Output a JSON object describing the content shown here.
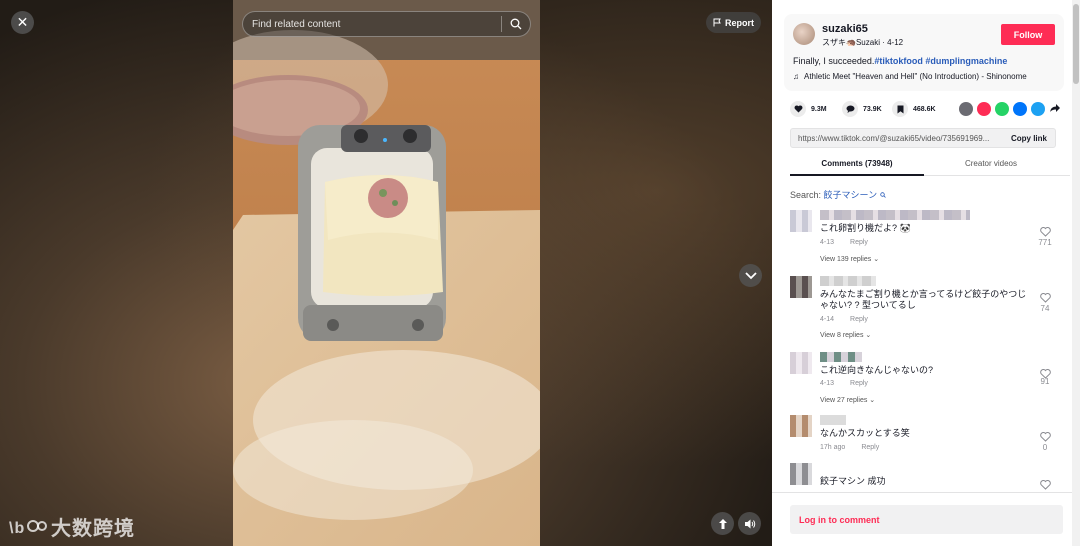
{
  "overlay": {
    "search_placeholder": "Find related content",
    "report_label": "Report",
    "watermark_text": "大数跨境"
  },
  "author": {
    "username": "suzaki65",
    "display": "スザキ🦔Suzaki",
    "date": "4-12",
    "follow_label": "Follow"
  },
  "post": {
    "desc_text": "Finally, I succeeded.",
    "hashtag1": "#tiktokfood",
    "hashtag2": "#dumplingmachine",
    "music": "Athletic Meet \"Heaven and Hell\" (No Introduction) - Shinonome"
  },
  "stats": {
    "likes": "9.3M",
    "comments": "73.9K",
    "saves": "468.6K"
  },
  "share": {
    "url": "https://www.tiktok.com/@suzaki65/video/735691969...",
    "copy_label": "Copy link"
  },
  "tabs": {
    "comments_label": "Comments (73948)",
    "creator_label": "Creator videos"
  },
  "search_suggest": {
    "prefix": "Search:",
    "term": "餃子マシーン"
  },
  "comments": [
    {
      "text": "これ卵割り機だよ? 🐼",
      "date": "4-13",
      "reply": "Reply",
      "likes": "771",
      "view_replies": "View 139 replies"
    },
    {
      "text": "みんなたまご割り機とか言ってるけど餃子のやつじゃない? ? 型ついてるし",
      "date": "4-14",
      "reply": "Reply",
      "likes": "74",
      "view_replies": "View 8 replies"
    },
    {
      "text": "これ逆向きなんじゃないの?",
      "date": "4-13",
      "reply": "Reply",
      "likes": "91",
      "view_replies": "View 27 replies"
    },
    {
      "text": "なんかスカッとする笑",
      "date": "17h ago",
      "reply": "Reply",
      "likes": "0",
      "view_replies": ""
    },
    {
      "text": "餃子マシン 成功",
      "date": "",
      "reply": "",
      "likes": "",
      "view_replies": ""
    }
  ],
  "footer": {
    "login_label": "Log in to comment"
  },
  "colors": {
    "brand": "#fe2c55",
    "link": "#2b5db9"
  }
}
